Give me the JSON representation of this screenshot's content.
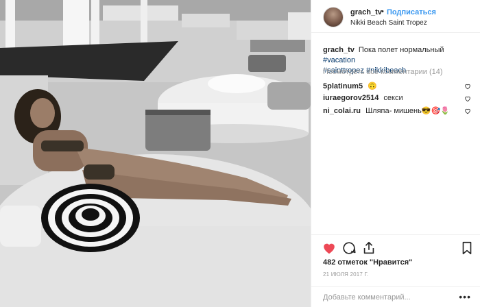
{
  "header": {
    "username": "grach_tv",
    "separator": "•",
    "follow_label": "Подписаться",
    "location": "Nikki Beach Saint Tropez"
  },
  "caption": {
    "username": "grach_tv",
    "text": "Пока полет нормальный",
    "hashtags": [
      "#vacation",
      "#sainttropez",
      "#nikkibeach"
    ]
  },
  "view_all_comments": "Посмотреть все комментарии (14)",
  "comments": [
    {
      "username": "5platinum5",
      "text": "🙃"
    },
    {
      "username": "iuraegorov2514",
      "text": "секси"
    },
    {
      "username": "ni_colai.ru",
      "text": "Шляпа- мишень😎🎯🌷"
    }
  ],
  "likes": "482 отметок \"Нравится\"",
  "date": "21 ИЮЛЯ 2017 Г.",
  "add_comment_placeholder": "Добавьте комментарий...",
  "more_label": "•••",
  "colors": {
    "accent": "#3897f0",
    "hashtag": "#003569",
    "like_red": "#ed4956",
    "muted": "#999999"
  },
  "icons": [
    "heart-icon",
    "comment-icon",
    "share-icon",
    "bookmark-icon"
  ]
}
